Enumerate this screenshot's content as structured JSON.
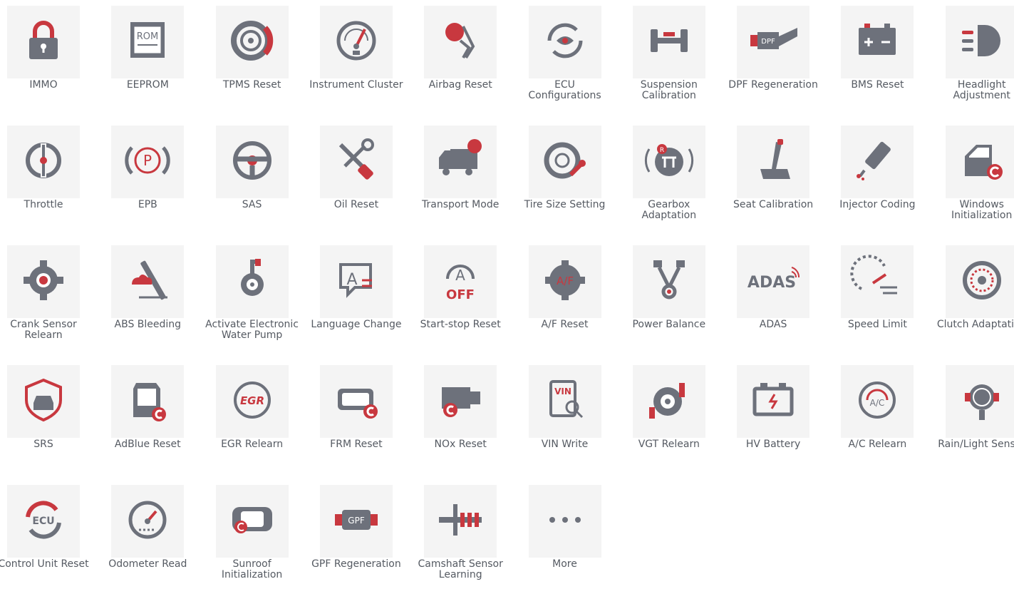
{
  "colors": {
    "tile_bg": "#f4f4f4",
    "icon_gray": "#6d717b",
    "icon_red": "#c8383f",
    "label": "#555a62"
  },
  "functions": [
    {
      "label": "IMMO",
      "icon": "padlock-icon"
    },
    {
      "label": "EEPROM",
      "icon": "rom-chip-icon"
    },
    {
      "label": "TPMS Reset",
      "icon": "tire-icon"
    },
    {
      "label": "Instrument Cluster",
      "icon": "gauge-icon"
    },
    {
      "label": "Airbag Reset",
      "icon": "airbag-icon"
    },
    {
      "label": "ECU Configurations",
      "icon": "eye-refresh-icon"
    },
    {
      "label": "Suspension Calibration",
      "icon": "axle-icon"
    },
    {
      "label": "DPF Regeneration",
      "icon": "dpf-filter-icon"
    },
    {
      "label": "BMS Reset",
      "icon": "battery-icon"
    },
    {
      "label": "Headlight Adjustment",
      "icon": "headlight-icon"
    },
    {
      "label": "Throttle",
      "icon": "throttle-icon"
    },
    {
      "label": "EPB",
      "icon": "parking-brake-icon"
    },
    {
      "label": "SAS",
      "icon": "steering-wheel-icon"
    },
    {
      "label": "Oil Reset",
      "icon": "wrench-screwdriver-icon"
    },
    {
      "label": "Transport Mode",
      "icon": "truck-icon"
    },
    {
      "label": "Tire Size Setting",
      "icon": "tire-wrench-icon"
    },
    {
      "label": "Gearbox Adaptation",
      "icon": "gear-shift-icon"
    },
    {
      "label": "Seat Calibration",
      "icon": "seat-icon"
    },
    {
      "label": "Injector Coding",
      "icon": "injector-icon"
    },
    {
      "label": "Windows Initialization",
      "icon": "car-door-icon"
    },
    {
      "label": "Crank Sensor Relearn",
      "icon": "cog-icon"
    },
    {
      "label": "ABS Bleeding",
      "icon": "abs-bleed-icon"
    },
    {
      "label": "Activate Electronic Water Pump",
      "icon": "water-pump-icon"
    },
    {
      "label": "Language Change",
      "icon": "language-icon"
    },
    {
      "label": "Start-stop Reset",
      "icon": "auto-off-icon"
    },
    {
      "label": "A/F Reset",
      "icon": "af-cog-icon"
    },
    {
      "label": "Power Balance",
      "icon": "pistons-icon"
    },
    {
      "label": "ADAS",
      "icon": "adas-icon"
    },
    {
      "label": "Speed Limit",
      "icon": "speed-limit-icon"
    },
    {
      "label": "Clutch Adaptation",
      "icon": "clutch-icon"
    },
    {
      "label": "SRS",
      "icon": "car-shield-icon"
    },
    {
      "label": "AdBlue Reset",
      "icon": "adblue-tank-icon"
    },
    {
      "label": "EGR Relearn",
      "icon": "egr-icon"
    },
    {
      "label": "FRM Reset",
      "icon": "module-icon"
    },
    {
      "label": "NOx Reset",
      "icon": "nox-sensor-icon"
    },
    {
      "label": "VIN Write",
      "icon": "vin-search-icon"
    },
    {
      "label": "VGT Relearn",
      "icon": "turbo-icon"
    },
    {
      "label": "HV Battery",
      "icon": "hv-battery-icon"
    },
    {
      "label": "A/C Relearn",
      "icon": "ac-gauge-icon"
    },
    {
      "label": "Rain/Light Sensor",
      "icon": "rain-sensor-icon"
    },
    {
      "label": "Control Unit Reset",
      "icon": "ecu-reset-icon"
    },
    {
      "label": "Odometer Read",
      "icon": "odometer-icon"
    },
    {
      "label": "Sunroof Initialization",
      "icon": "sunroof-icon"
    },
    {
      "label": "GPF Regeneration",
      "icon": "gpf-filter-icon"
    },
    {
      "label": "Camshaft Sensor Learning",
      "icon": "camshaft-icon"
    },
    {
      "label": "More",
      "icon": "more-dots-icon"
    }
  ],
  "icon_text": {
    "rom": "ROM",
    "dpf": "DPF",
    "vin": "VIN",
    "egr": "EGR",
    "gpf": "GPF",
    "ecu": "ECU",
    "adas": "ADAS",
    "af": "A/F",
    "a": "A",
    "off": "OFF",
    "ac": "A/C",
    "r": "R"
  }
}
